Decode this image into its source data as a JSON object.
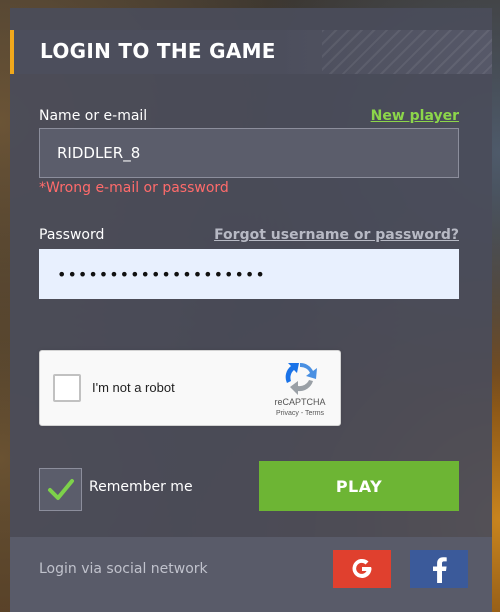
{
  "header": {
    "title": "LOGIN TO THE GAME"
  },
  "login_field": {
    "label": "Name or e-mail",
    "value": "RIDDLER_8",
    "new_player_link": "New player",
    "error": "*Wrong e-mail or password"
  },
  "password_field": {
    "label": "Password",
    "masked_value": "••••••••••••••••••••",
    "forgot_link": "Forgot username or password?"
  },
  "captcha": {
    "label": "I'm not a robot",
    "brand": "reCAPTCHA",
    "terms": "Privacy - Terms"
  },
  "remember": {
    "label": "Remember me",
    "checked": true
  },
  "play_button": {
    "label": "PLAY"
  },
  "footer": {
    "social_label": "Login via social network",
    "google_icon": "google-icon",
    "facebook_icon": "facebook-icon"
  },
  "colors": {
    "accent": "#f0a81c",
    "link_green": "#8cd64a",
    "error_red": "#ff6b6b",
    "play_green": "#6db534",
    "google_red": "#e0402e",
    "facebook_blue": "#3b5a9a"
  }
}
